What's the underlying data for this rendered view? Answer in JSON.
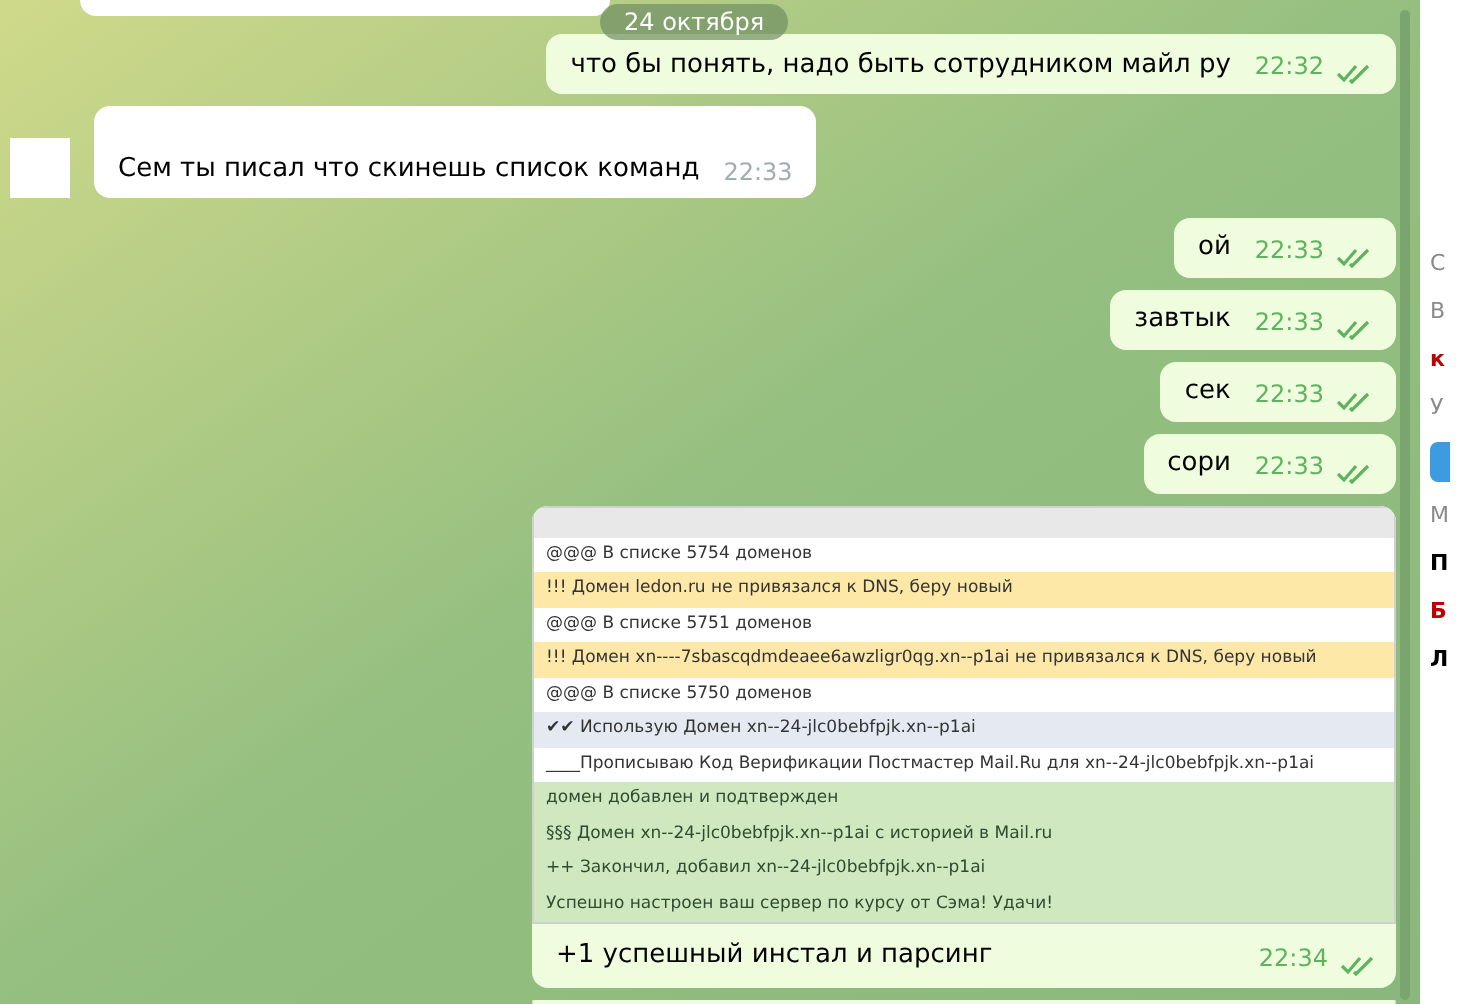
{
  "date_badge": "24 октября",
  "messages": [
    {
      "kind": "text",
      "outgoing": true,
      "text": "что бы понять, надо быть сотрудником майл ру",
      "time": "22:32",
      "read": true
    },
    {
      "kind": "text",
      "outgoing": false,
      "text": "Сем ты писал что скинешь список команд",
      "time": "22:33",
      "read": false
    },
    {
      "kind": "text",
      "outgoing": true,
      "text": "ой",
      "time": "22:33",
      "read": true
    },
    {
      "kind": "text",
      "outgoing": true,
      "text": "завтык",
      "time": "22:33",
      "read": true
    },
    {
      "kind": "text",
      "outgoing": true,
      "text": "сек",
      "time": "22:33",
      "read": true
    },
    {
      "kind": "text",
      "outgoing": true,
      "text": "сори",
      "time": "22:33",
      "read": true
    },
    {
      "kind": "log",
      "outgoing": true,
      "text": "+1 успешный инстал и парсинг",
      "time": "22:34",
      "read": true,
      "log_rows": [
        {
          "kind": "plain",
          "text": "@@@ В списке 5754 доменов"
        },
        {
          "kind": "warning",
          "text": "!!! Домен ledon.ru не привязался к DNS, беру новый"
        },
        {
          "kind": "plain",
          "text": "@@@ В списке 5751 доменов"
        },
        {
          "kind": "warning",
          "text": "!!! Домен xn----7sbascqdmdeaee6awzligr0qg.xn--p1ai не привязался к DNS, беру новый"
        },
        {
          "kind": "plain",
          "text": "@@@ В списке 5750 доменов"
        },
        {
          "kind": "selected",
          "text": "✔✔ Использую Домен xn--24-jlc0bebfpjk.xn--p1ai"
        },
        {
          "kind": "plain",
          "text": "____Прописываю Код Верификации Постмастер Mail.Ru для xn--24-jlc0bebfpjk.xn--p1ai"
        },
        {
          "kind": "success",
          "text": "домен добавлен и подтвержден"
        },
        {
          "kind": "success",
          "text": "§§§ Домен xn--24-jlc0bebfpjk.xn--p1ai с историей в Mail.ru"
        },
        {
          "kind": "success",
          "text": "++ Закончил, добавил xn--24-jlc0bebfpjk.xn--p1ai"
        },
        {
          "kind": "success",
          "text": "Успешно настроен ваш сервер по курсу от Сэма! Удачи!"
        }
      ]
    }
  ],
  "side_panel": [
    {
      "kind": "gray",
      "text": "С"
    },
    {
      "kind": "gray",
      "text": "В"
    },
    {
      "kind": "red",
      "text": "к"
    },
    {
      "kind": "gray",
      "text": "У"
    },
    {
      "kind": "button"
    },
    {
      "kind": "gray",
      "text": "М"
    },
    {
      "kind": "bold",
      "text": "П"
    },
    {
      "kind": "red",
      "text": "Б"
    },
    {
      "kind": "bold",
      "text": "Л"
    }
  ]
}
